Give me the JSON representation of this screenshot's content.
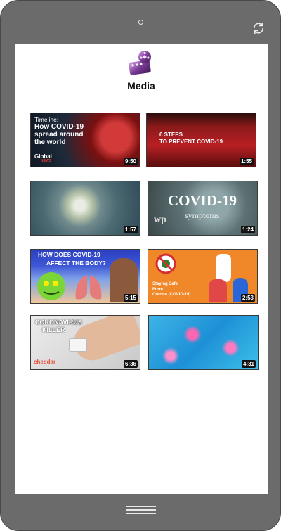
{
  "app": {
    "title": "Media"
  },
  "videos": [
    {
      "lines": [
        "Timeline:",
        "How COVID-19",
        "spread around",
        "the world"
      ],
      "brand": "Global",
      "brand_sub": "NEWS",
      "duration": "9:50"
    },
    {
      "lines": [
        "6 STEPS",
        "TO PREVENT COVID-19"
      ],
      "duration": "1:55"
    },
    {
      "duration": "1:57"
    },
    {
      "lines": [
        "COVID-19",
        "symptoms"
      ],
      "brand": "wp",
      "duration": "1:24"
    },
    {
      "lines": [
        "HOW DOES COVID-19",
        "AFFECT THE BODY?"
      ],
      "duration": "5:15"
    },
    {
      "lines": [
        "Staying Safe",
        "From",
        "Corona (COVID-19)"
      ],
      "duration": "2:53"
    },
    {
      "lines": [
        "CORONAVIRUS",
        "KILLER"
      ],
      "brand": "cheddar",
      "duration": "6:36"
    },
    {
      "duration": "4:31"
    }
  ],
  "colors": {
    "frame": "#6b6b6b",
    "screen": "#ffffff",
    "accent": "#c2185b"
  },
  "icons": [
    "camera-icon",
    "rotate-icon",
    "film-reel-icon",
    "home-icon"
  ]
}
